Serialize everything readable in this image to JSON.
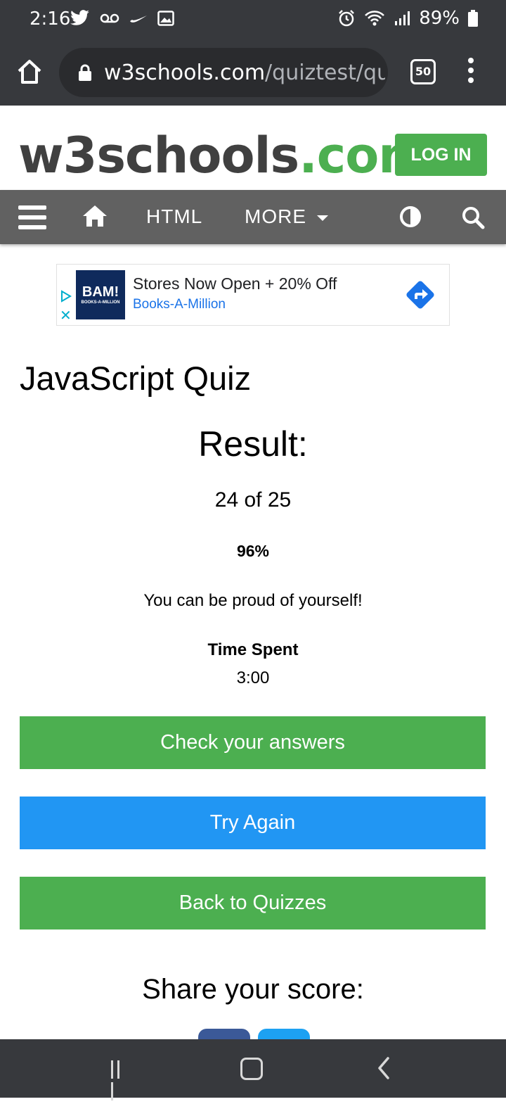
{
  "status_bar": {
    "time": "2:16",
    "battery": "89%"
  },
  "browser": {
    "url_domain": "w3schools.com",
    "url_path": "/quiztest/qu",
    "tab_count": "50"
  },
  "site_header": {
    "logo_main": "w3schools",
    "logo_suffix": ".com",
    "login_label": "LOG IN"
  },
  "navbar": {
    "html_label": "HTML",
    "more_label": "MORE"
  },
  "ad": {
    "brand_logo": "BAM!",
    "brand_logo_sub": "BOOKS-A-MILLION",
    "headline": "Stores Now Open + 20% Off",
    "advertiser": "Books-A-Million"
  },
  "page": {
    "title": "JavaScript Quiz",
    "result_title": "Result:",
    "score": "24 of 25",
    "percent": "96%",
    "message": "You can be proud of yourself!",
    "time_label": "Time Spent",
    "time_value": "3:00",
    "check_button": "Check your answers",
    "try_button": "Try Again",
    "back_button": "Back to Quizzes",
    "share_title": "Share your score:"
  },
  "colors": {
    "green": "#4CAF50",
    "blue": "#2196F3",
    "nav_gray": "#616161",
    "chrome_dark": "#37393d"
  }
}
